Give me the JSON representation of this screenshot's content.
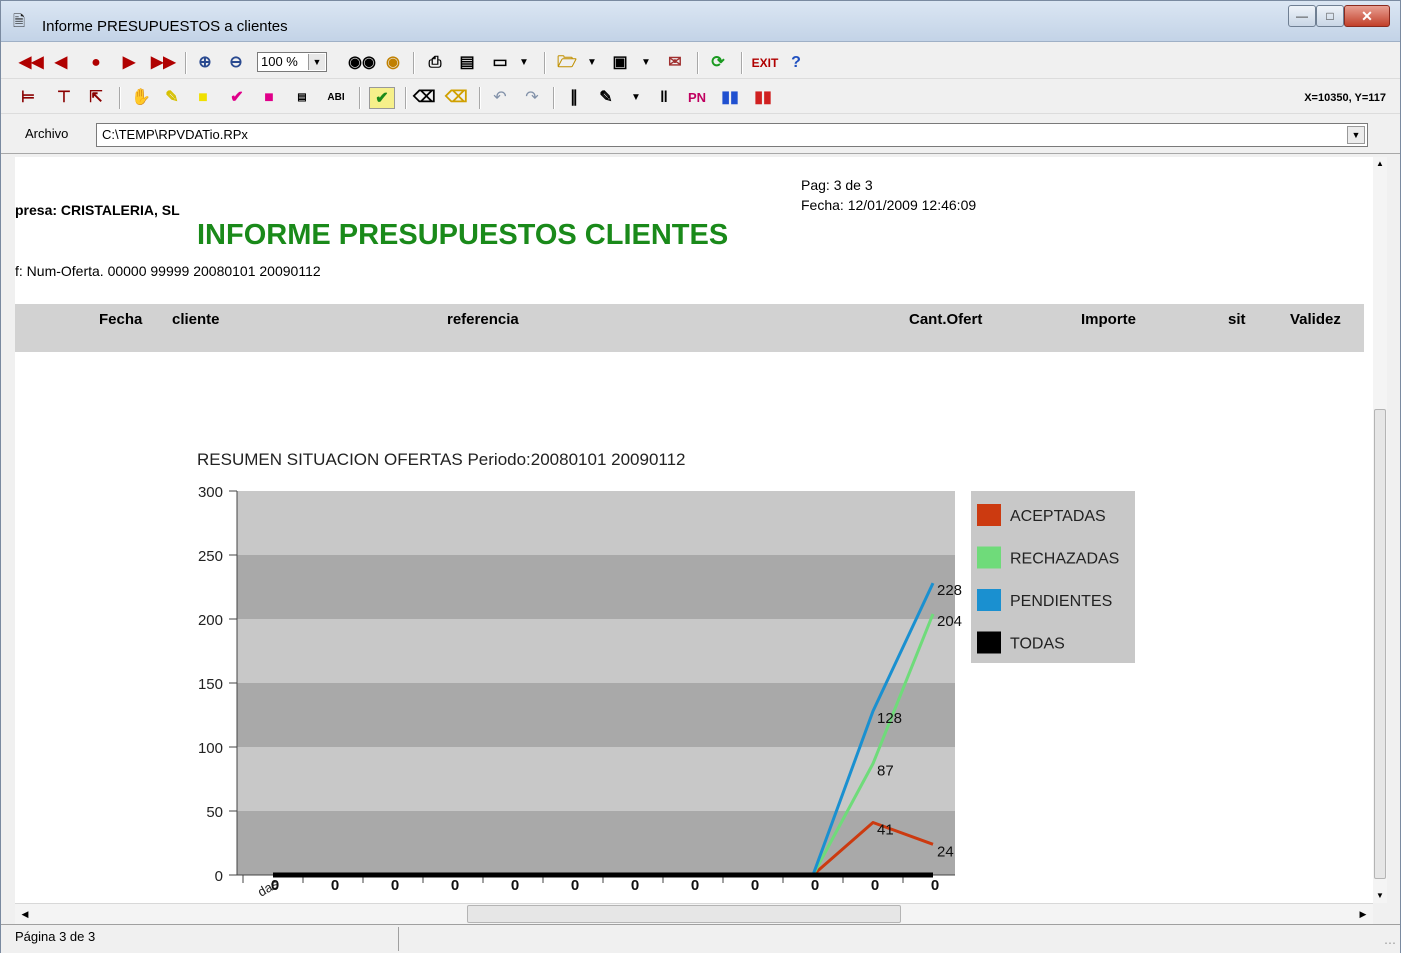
{
  "window": {
    "title": "Informe PRESUPUESTOS a clientes"
  },
  "toolbar": {
    "zoom": "100 %",
    "exit_label": "EXIT",
    "help_label": "?",
    "pn_label": "PN",
    "abi_label": "ABI",
    "coords": "X=10350, Y=117"
  },
  "filebar": {
    "label": "Archivo",
    "path": "C:\\TEMP\\RPVDATio.RPx"
  },
  "report": {
    "page": "Pag: 3 de 3",
    "date": "Fecha: 12/01/2009 12:46:09",
    "company": "presa: CRISTALERIA, SL",
    "title": "INFORME PRESUPUESTOS CLIENTES",
    "filter": "f: Num-Oferta. 00000 99999 20080101 20090112",
    "columns": [
      "Fecha",
      "cliente",
      "referencia",
      "Cant.Ofert",
      "Importe",
      "sit",
      "Validez"
    ]
  },
  "chart_data": {
    "type": "line",
    "title": "RESUMEN SITUACION OFERTAS Periodo:20080101  20090112",
    "ylim": [
      0,
      300
    ],
    "yticks": [
      0,
      50,
      100,
      150,
      200,
      250,
      300
    ],
    "first_xtick": "das",
    "x_index": [
      0,
      1,
      2,
      3,
      4,
      5,
      6,
      7,
      8,
      9,
      10,
      11
    ],
    "legend_position": "right",
    "series": [
      {
        "name": "ACEPTADAS",
        "color": "#cc3a10",
        "values": [
          0,
          0,
          0,
          0,
          0,
          0,
          0,
          0,
          0,
          0,
          41,
          24
        ]
      },
      {
        "name": "RECHAZADAS",
        "color": "#6fdb7a",
        "values": [
          0,
          0,
          0,
          0,
          0,
          0,
          0,
          0,
          0,
          0,
          87,
          204
        ]
      },
      {
        "name": "PENDIENTES",
        "color": "#1a90d0",
        "values": [
          0,
          0,
          0,
          0,
          0,
          0,
          0,
          0,
          0,
          0,
          128,
          228
        ]
      },
      {
        "name": "TODAS",
        "color": "#000000",
        "values": [
          0,
          0,
          0,
          0,
          0,
          0,
          0,
          0,
          0,
          0,
          0,
          0
        ]
      }
    ],
    "value_labels": [
      "0",
      "0",
      "0",
      "0",
      "0",
      "0",
      "0",
      "0",
      "0",
      "0",
      "0",
      "0"
    ],
    "point_labels": [
      {
        "series": "PENDIENTES",
        "index": 11,
        "text": "228"
      },
      {
        "series": "RECHAZADAS",
        "index": 11,
        "text": "204"
      },
      {
        "series": "PENDIENTES",
        "index": 10,
        "text": "128"
      },
      {
        "series": "RECHAZADAS",
        "index": 10,
        "text": "87"
      },
      {
        "series": "ACEPTADAS",
        "index": 10,
        "text": "41"
      },
      {
        "series": "ACEPTADAS",
        "index": 11,
        "text": "24"
      }
    ]
  },
  "status": {
    "page": "Página 3 de 3"
  }
}
